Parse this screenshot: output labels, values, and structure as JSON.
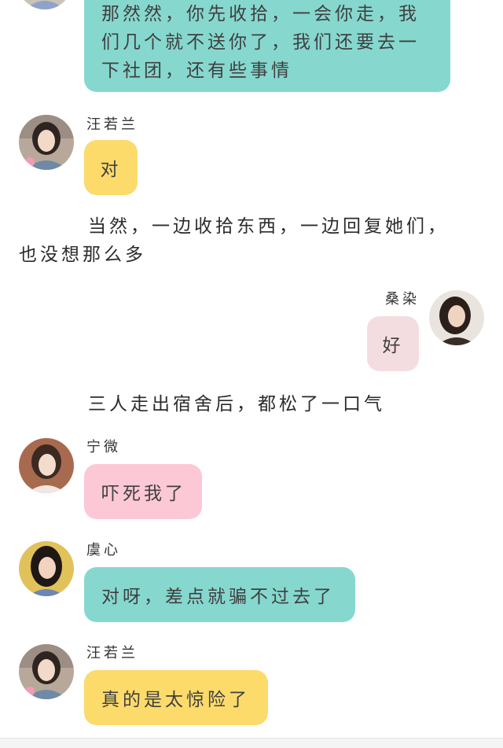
{
  "messages": [
    {
      "lines": [
        "那然然，你先收拾，一会你走，我",
        "们几个就不送你了，我们还要去一",
        "下社团，还有些事情"
      ]
    },
    {
      "speaker": "汪若兰",
      "text": "对"
    },
    {
      "speaker": "桑染",
      "text": "好"
    },
    {
      "speaker": "宁微",
      "text": "吓死我了"
    },
    {
      "speaker": "虞心",
      "text": "对呀，差点就骗不过去了"
    },
    {
      "speaker": "汪若兰",
      "text": "真的是太惊险了"
    }
  ],
  "narration": [
    {
      "lines": [
        "当然，一边收拾东西，一边回复她们，",
        "也没想那么多"
      ]
    },
    {
      "lines": [
        "三人走出宿舍后，都松了一口气"
      ]
    }
  ],
  "avatars": [
    {
      "icon": "girl-portrait-avatar",
      "bg": "#c9c3b8"
    },
    {
      "icon": "girl-portrait-avatar",
      "bg": "#b7a89a"
    },
    {
      "icon": "girl-portrait-avatar",
      "bg": "#a86a4f"
    },
    {
      "icon": "girl-portrait-avatar",
      "bg": "#e1c15a"
    }
  ],
  "colors": {
    "teal": "#86d8cf",
    "yellow": "#fcdb6b",
    "pink": "#fcc8d6",
    "blush": "#f4dde0"
  }
}
